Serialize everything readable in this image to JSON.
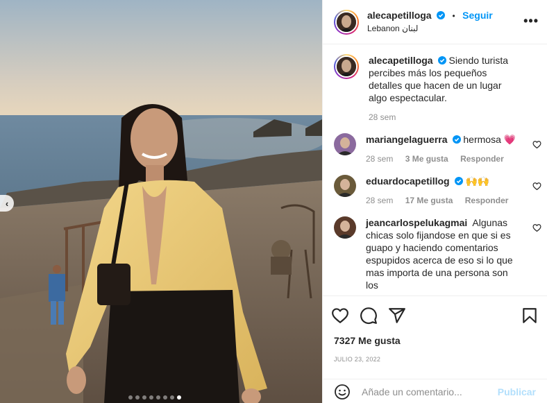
{
  "post": {
    "username": "alecapetilloga",
    "follow_label": "Seguir",
    "bullet": "•",
    "location": "Lebanon لبنان",
    "more_label": "•••",
    "carousel": {
      "total": 8,
      "active_index": 7
    },
    "prev_label": "‹"
  },
  "caption": {
    "username": "alecapetilloga",
    "text": "Siendo turista percibes más los pequeños detalles que hacen de un lugar algo espectacular.",
    "time": "28 sem"
  },
  "comments": [
    {
      "username": "mariangelaguerra",
      "text": "hermosa 💗",
      "time": "28 sem",
      "likes": "3 Me gusta",
      "reply": "Responder",
      "verified": true,
      "avatar_color": "#8b6a9e"
    },
    {
      "username": "eduardocapetillog",
      "text": "🙌🙌",
      "time": "28 sem",
      "likes": "17 Me gusta",
      "reply": "Responder",
      "verified": true,
      "avatar_color": "#6a5a3a"
    },
    {
      "username": "jeancarlospelukagmai",
      "text": "Algunas chicas solo fijandose en que si es guapo y haciendo comentarios espupidos acerca de eso si lo que mas importa de una persona son los",
      "time": "",
      "likes": "",
      "reply": "",
      "verified": false,
      "avatar_color": "#5a3a2a"
    }
  ],
  "actions": {
    "likes": "7327 Me gusta",
    "date": "JULIO 23, 2022",
    "comment_placeholder": "Añade un comentario...",
    "publish_label": "Publicar"
  },
  "icons": [
    "verified-icon",
    "heart-icon",
    "comment-icon",
    "share-icon",
    "bookmark-icon",
    "emoji-icon",
    "chevron-left-icon"
  ],
  "colors": {
    "accent": "#0095f6",
    "verified": "#0095f6",
    "publish_disabled": "#b2dffc",
    "muted": "#8e8e8e"
  }
}
